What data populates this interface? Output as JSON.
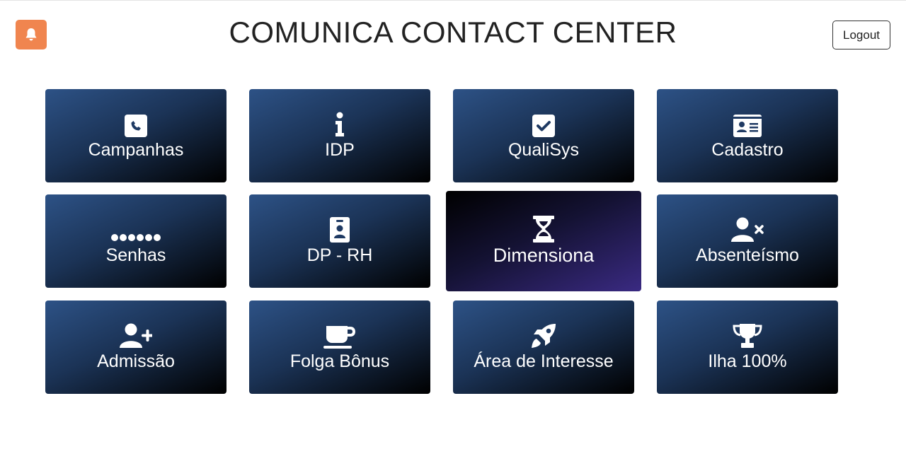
{
  "header": {
    "title": "COMUNICA CONTACT CENTER",
    "logout_label": "Logout",
    "bell_color": "#f0854f"
  },
  "menu": {
    "items": [
      {
        "label": "Campanhas",
        "icon": "phone-square-icon"
      },
      {
        "label": "IDP",
        "icon": "info-icon"
      },
      {
        "label": "QualiSys",
        "icon": "check-square-icon"
      },
      {
        "label": "Cadastro",
        "icon": "id-card-icon"
      },
      {
        "label": "Senhas",
        "icon": "password-dots-icon"
      },
      {
        "label": "DP - RH",
        "icon": "id-badge-icon"
      },
      {
        "label": "Dimensiona",
        "icon": "hourglass-icon"
      },
      {
        "label": "Absenteísmo",
        "icon": "user-times-icon"
      },
      {
        "label": "Admissão",
        "icon": "user-plus-icon"
      },
      {
        "label": "Folga Bônus",
        "icon": "coffee-icon"
      },
      {
        "label": "Área de Interesse",
        "icon": "rocket-icon"
      },
      {
        "label": "Ilha 100%",
        "icon": "trophy-icon"
      }
    ]
  },
  "colors": {
    "card_gradient_start": "#2d5286",
    "card_gradient_end": "#000000",
    "active_card_gradient_end": "#3a2a82"
  }
}
